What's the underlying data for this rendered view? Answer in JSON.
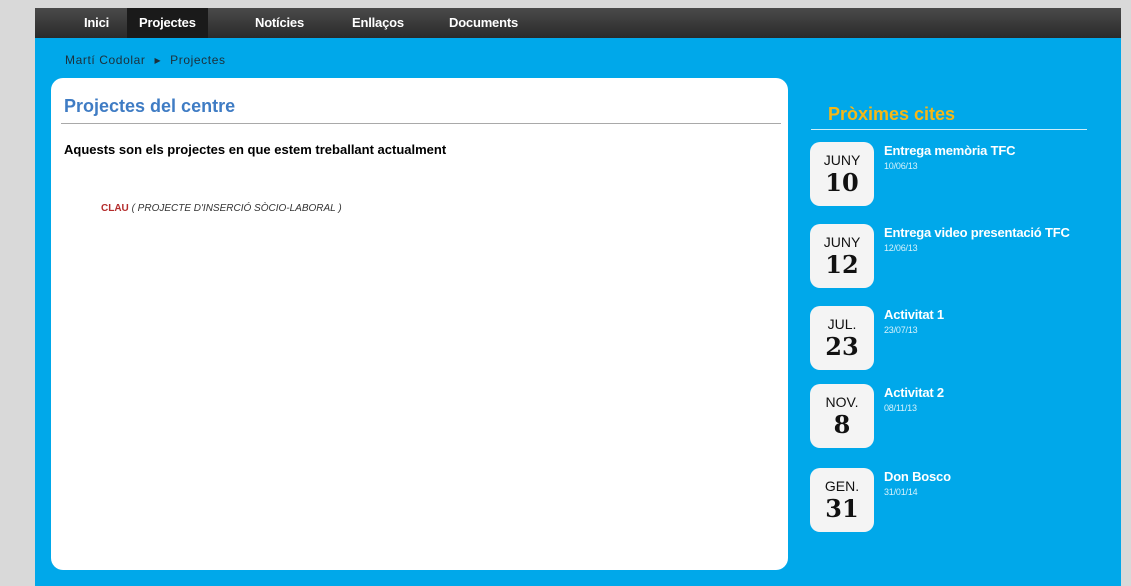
{
  "nav": {
    "items": [
      "Inici",
      "Projectes",
      "Notícies",
      "Enllaços",
      "Documents"
    ],
    "active": "Projectes"
  },
  "breadcrumb": {
    "home": "Martí Codolar",
    "current": "Projectes"
  },
  "main": {
    "title": "Projectes del centre",
    "intro": "Aquests son els projectes en que estem treballant actualment",
    "projects": [
      {
        "name": "CLAU",
        "description": "( PROJECTE D'INSERCIÓ SÒCIO-LABORAL )"
      }
    ]
  },
  "sidebar": {
    "title": "Pròximes cites",
    "events": [
      {
        "month": "JUNY",
        "day": "10",
        "title": "Entrega memòria TFC",
        "date": "10/06/13"
      },
      {
        "month": "JUNY",
        "day": "12",
        "title": "Entrega video presentació TFC",
        "date": "12/06/13"
      },
      {
        "month": "JUL.",
        "day": "23",
        "title": "Activitat 1",
        "date": "23/07/13"
      },
      {
        "month": "NOV.",
        "day": "8",
        "title": "Activitat 2",
        "date": "08/11/13"
      },
      {
        "month": "GEN.",
        "day": "31",
        "title": "Don Bosco",
        "date": "31/01/14"
      }
    ]
  },
  "colors": {
    "background_blue": "#00a8ea",
    "title_blue": "#3f7cc4",
    "sidebar_title_orange": "#f5b716",
    "project_red": "#b42c2c"
  }
}
